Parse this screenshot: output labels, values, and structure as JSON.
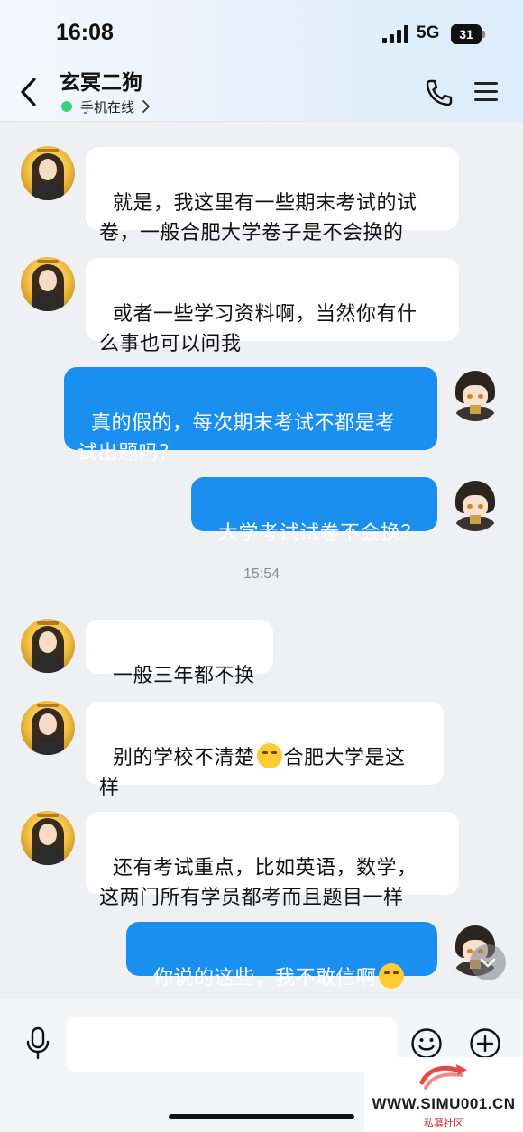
{
  "status_bar": {
    "time": "16:08",
    "network": "5G",
    "battery": "31"
  },
  "header": {
    "title": "玄冥二狗",
    "status": "手机在线"
  },
  "messages": [
    {
      "side": "in",
      "text": "就是，我这里有一些期末考试的试\n卷，一般合肥大学卷子是不会换的"
    },
    {
      "side": "in",
      "text": "或者一些学习资料啊，当然你有什\n么事也可以问我"
    },
    {
      "side": "out",
      "text": "真的假的，每次期末考试不都是考\n试出题吗？"
    },
    {
      "side": "out",
      "text": "大学考试试卷不会换？"
    },
    {
      "side": "in",
      "text": "一般三年都不换"
    },
    {
      "side": "in",
      "text_before": "别的学校不清楚",
      "emoji": "laughing-crying-emoji",
      "text_after": "合肥大学是这\n样"
    },
    {
      "side": "in",
      "text": "还有考试重点，比如英语，数学，\n这两门所有学员都考而且题目一样"
    },
    {
      "side": "out",
      "text_before": "你说的这些，我不敢信啊",
      "emoji": "skeptical-emoji",
      "text_after": ""
    }
  ],
  "timestamp": "15:54",
  "composer": {
    "placeholder": ""
  },
  "icons": [
    "back-arrow-icon",
    "phone-icon",
    "menu-icon",
    "microphone-icon",
    "smiley-icon",
    "plus-icon",
    "chevron-down-icon",
    "chevron-right-icon"
  ],
  "watermark": {
    "url": "WWW.SIMU001.CN",
    "label": "私募社区"
  },
  "colors": {
    "outgoing_bubble": "#1a8ff0",
    "incoming_bubble": "#ffffff",
    "online": "#3ad17a"
  }
}
